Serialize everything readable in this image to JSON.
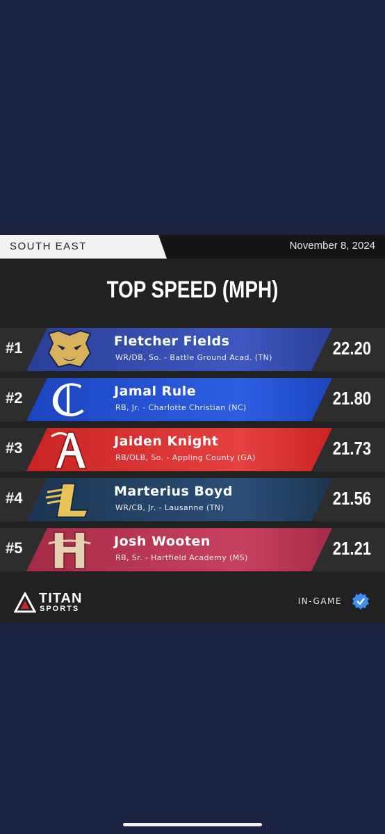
{
  "header": {
    "region": "SOUTH EAST",
    "date": "November 8, 2024"
  },
  "title": "TOP SPEED (MPH)",
  "players": [
    {
      "rank": "#1",
      "name": "Fletcher Fields",
      "detail": "WR/DB, So. - Battle Ground Acad. (TN)",
      "speed": "22.20",
      "band_color": "#2a3f97",
      "logo": "bobcat-logo-icon"
    },
    {
      "rank": "#2",
      "name": "Jamal Rule",
      "detail": "RB, Jr. - Charlotte Christian (NC)",
      "speed": "21.80",
      "band_color": "#1f49c4",
      "logo": "c-letter-logo-icon"
    },
    {
      "rank": "#3",
      "name": "Jaiden Knight",
      "detail": "RB/OLB, So. - Appling County (GA)",
      "speed": "21.73",
      "band_color": "#d42b2b",
      "logo": "a-letter-logo-icon"
    },
    {
      "rank": "#4",
      "name": "Marterius Boyd",
      "detail": "WR/CB, Jr. - Lausanne (TN)",
      "speed": "21.56",
      "band_color": "#203a5a",
      "logo": "l-letter-logo-icon"
    },
    {
      "rank": "#5",
      "name": "Josh Wooten",
      "detail": "RB, Sr. - Hartfield Academy (MS)",
      "speed": "21.21",
      "band_color": "#b1324e",
      "logo": "h-letter-logo-icon"
    }
  ],
  "footer": {
    "brand_top": "TITAN",
    "brand_bottom": "SPORTS",
    "status": "IN-GAME"
  }
}
